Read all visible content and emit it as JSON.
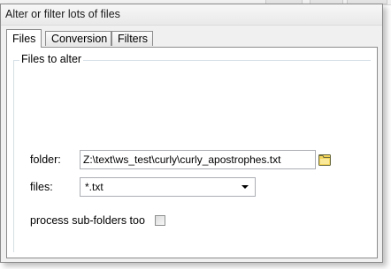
{
  "window": {
    "title": "Alter or filter lots of files"
  },
  "tabs": [
    {
      "label": "Files",
      "active": true
    },
    {
      "label": "Conversion",
      "active": false
    },
    {
      "label": "Filters",
      "active": false
    }
  ],
  "group": {
    "legend": "Files to alter"
  },
  "folder": {
    "label": "folder:",
    "value": "Z:\\text\\ws_test\\curly\\curly_apostrophes.txt",
    "browse_icon": "folder-icon"
  },
  "files": {
    "label": "files:",
    "value": "*.txt"
  },
  "subfolders": {
    "label": "process sub-folders too",
    "checked": false
  },
  "colors": {
    "window_bg": "#f0f0f0",
    "panel_bg": "#ffffff",
    "folder_icon": "#f2d35a"
  }
}
